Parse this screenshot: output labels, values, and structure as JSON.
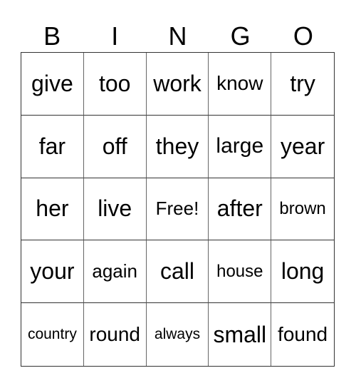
{
  "header": {
    "letters": [
      "B",
      "I",
      "N",
      "G",
      "O"
    ]
  },
  "grid": {
    "cells": [
      "give",
      "too",
      "work",
      "know",
      "try",
      "far",
      "off",
      "they",
      "large",
      "year",
      "her",
      "live",
      "Free!",
      "after",
      "brown",
      "your",
      "again",
      "call",
      "house",
      "long",
      "country",
      "round",
      "always",
      "small",
      "found"
    ]
  }
}
